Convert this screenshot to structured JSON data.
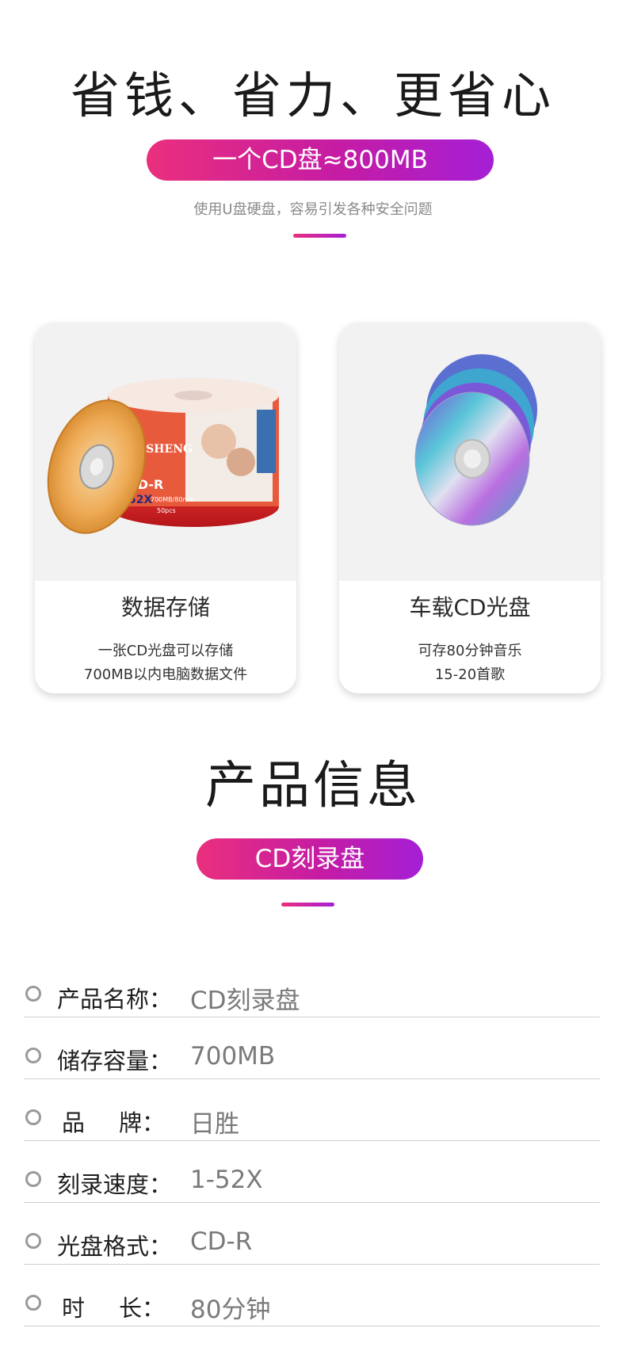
{
  "hero": {
    "title": "省钱、省力、更省心",
    "pill": "一个CD盘≈800MB",
    "subtitle": "使用U盘硬盘，容易引发各种安全问题"
  },
  "cards": [
    {
      "title": "数据存储",
      "line1": "一张CD光盘可以存储",
      "line2": "700MB以内电脑数据文件",
      "image_text": {
        "brand": "RISHENG",
        "type": "CD-R",
        "speed": "52X",
        "capacity": "700MB/80min",
        "count": "50pcs"
      }
    },
    {
      "title": "车载CD光盘",
      "line1": "可存80分钟音乐",
      "line2": "15-20首歌"
    }
  ],
  "product_info": {
    "title": "产品信息",
    "pill": "CD刻录盘"
  },
  "specs": [
    {
      "label": "产品名称：",
      "value": "CD刻录盘"
    },
    {
      "label": "储存容量：",
      "value": "700MB"
    },
    {
      "label_a": "品",
      "label_b": "牌：",
      "value": "日胜"
    },
    {
      "label": "刻录速度：",
      "value": "1-52X"
    },
    {
      "label": "光盘格式：",
      "value": "CD-R"
    },
    {
      "label_a": "时",
      "label_b": "长：",
      "value": "80分钟"
    }
  ],
  "colors": {
    "gradient_start": "#ea2f7d",
    "gradient_end": "#a51fd6",
    "divider": "#cfcfcf"
  }
}
